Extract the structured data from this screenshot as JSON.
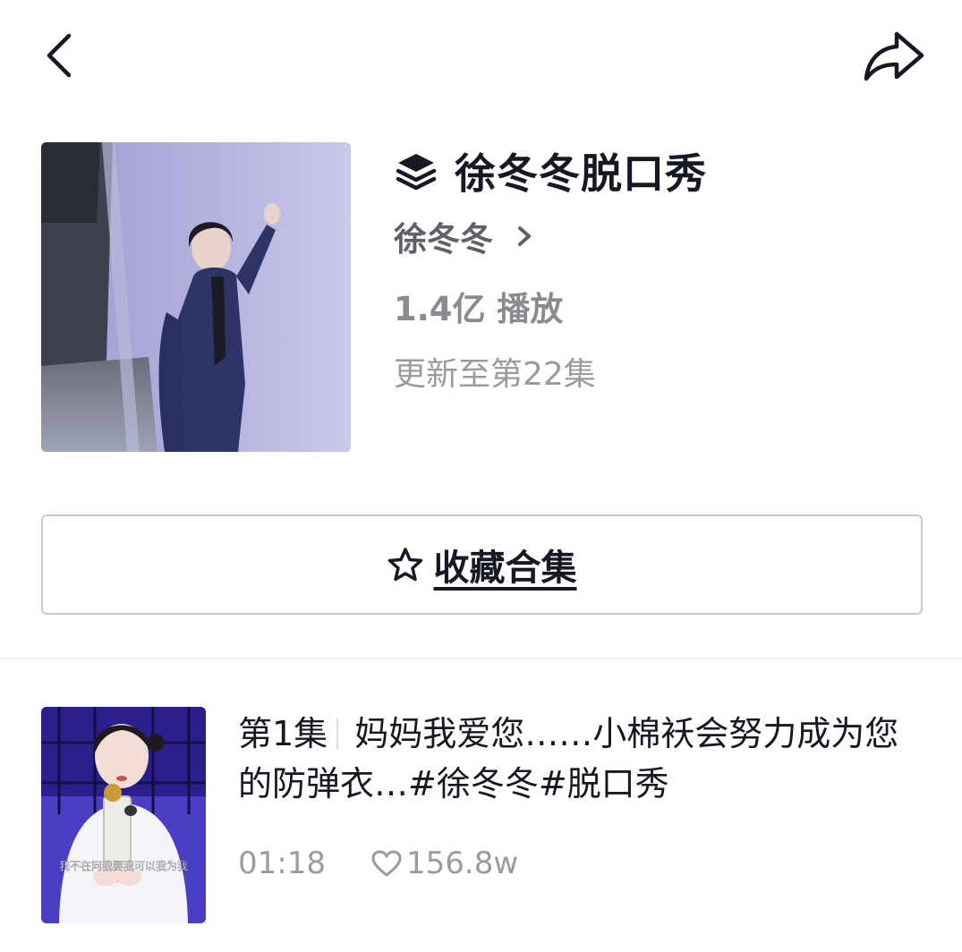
{
  "topbar": {
    "back_icon": "chevron-left-icon",
    "share_icon": "share-arrow-icon"
  },
  "collection": {
    "title": "徐冬冬脱口秀",
    "title_icon": "layers-icon",
    "author": "徐冬冬",
    "plays": "1.4亿 播放",
    "update": "更新至第22集"
  },
  "actions": {
    "collect_label": "收藏合集",
    "collect_icon": "star-outline-icon"
  },
  "episodes": [
    {
      "number": "第1集",
      "title": "妈妈我爱您……小棉袄会努力成为您的防弹衣…#徐冬冬#脱口秀",
      "duration": "01:18",
      "likes": "156.8w",
      "subtitle": "我不在问我要我可以我为我"
    }
  ]
}
